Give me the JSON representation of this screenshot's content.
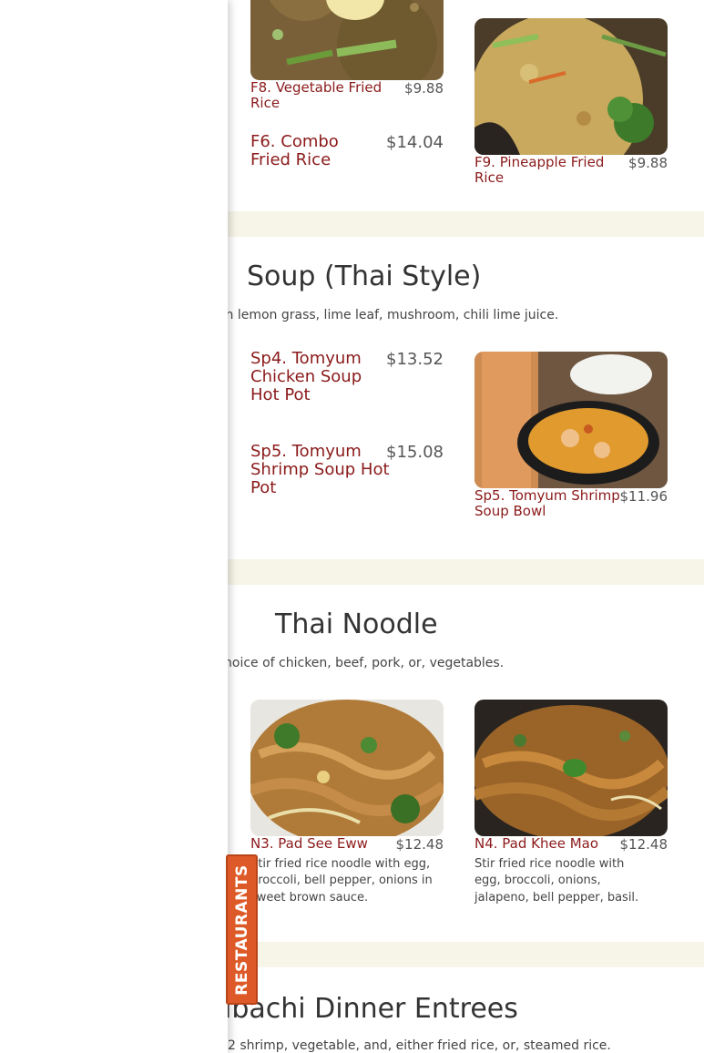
{
  "sections": [
    {
      "items": [
        {
          "name": "F8. Vegetable Fried Rice",
          "price": "$9.88"
        },
        {
          "name": "F9. Pineapple Fried Rice",
          "price": "$9.88"
        },
        {
          "name": "F6. Combo Fried Rice",
          "price": "$14.04"
        }
      ]
    },
    {
      "title": "Soup (Thai Style)",
      "description": "th lemon grass, lime leaf, mushroom, chili lime juice.",
      "items": [
        {
          "name": "Sp4. Tomyum Chicken Soup Hot Pot",
          "price": "$13.52"
        },
        {
          "name": "Sp5. Tomyum Shrimp Soup Bowl",
          "price": "$11.96"
        },
        {
          "name": "Sp5. Tomyum Shrimp Soup Hot Pot",
          "price": "$15.08"
        }
      ]
    },
    {
      "title": "Thai Noodle",
      "description": "hoice of chicken, beef, pork, or, vegetables.",
      "items": [
        {
          "name": "N3. Pad See Eww",
          "price": "$12.48",
          "description": "Stir fried rice noodle with egg, broccoli, bell pepper, onions in sweet brown sauce."
        },
        {
          "name": "N4. Pad Khee Mao",
          "price": "$12.48",
          "description": "Stir fried rice noodle with egg, broccoli, onions, jalapeno, bell pepper, basil."
        }
      ]
    },
    {
      "title": "ibachi Dinner Entrees",
      "description": "2 shrimp, vegetable, and, either fried rice, or, steamed rice."
    }
  ],
  "restaurants_tab": {
    "label": "RESTAURANTS"
  },
  "colors": {
    "item_name": "#8b1a1a",
    "tab": "#dd5a28",
    "band": "#f7f4e8"
  }
}
